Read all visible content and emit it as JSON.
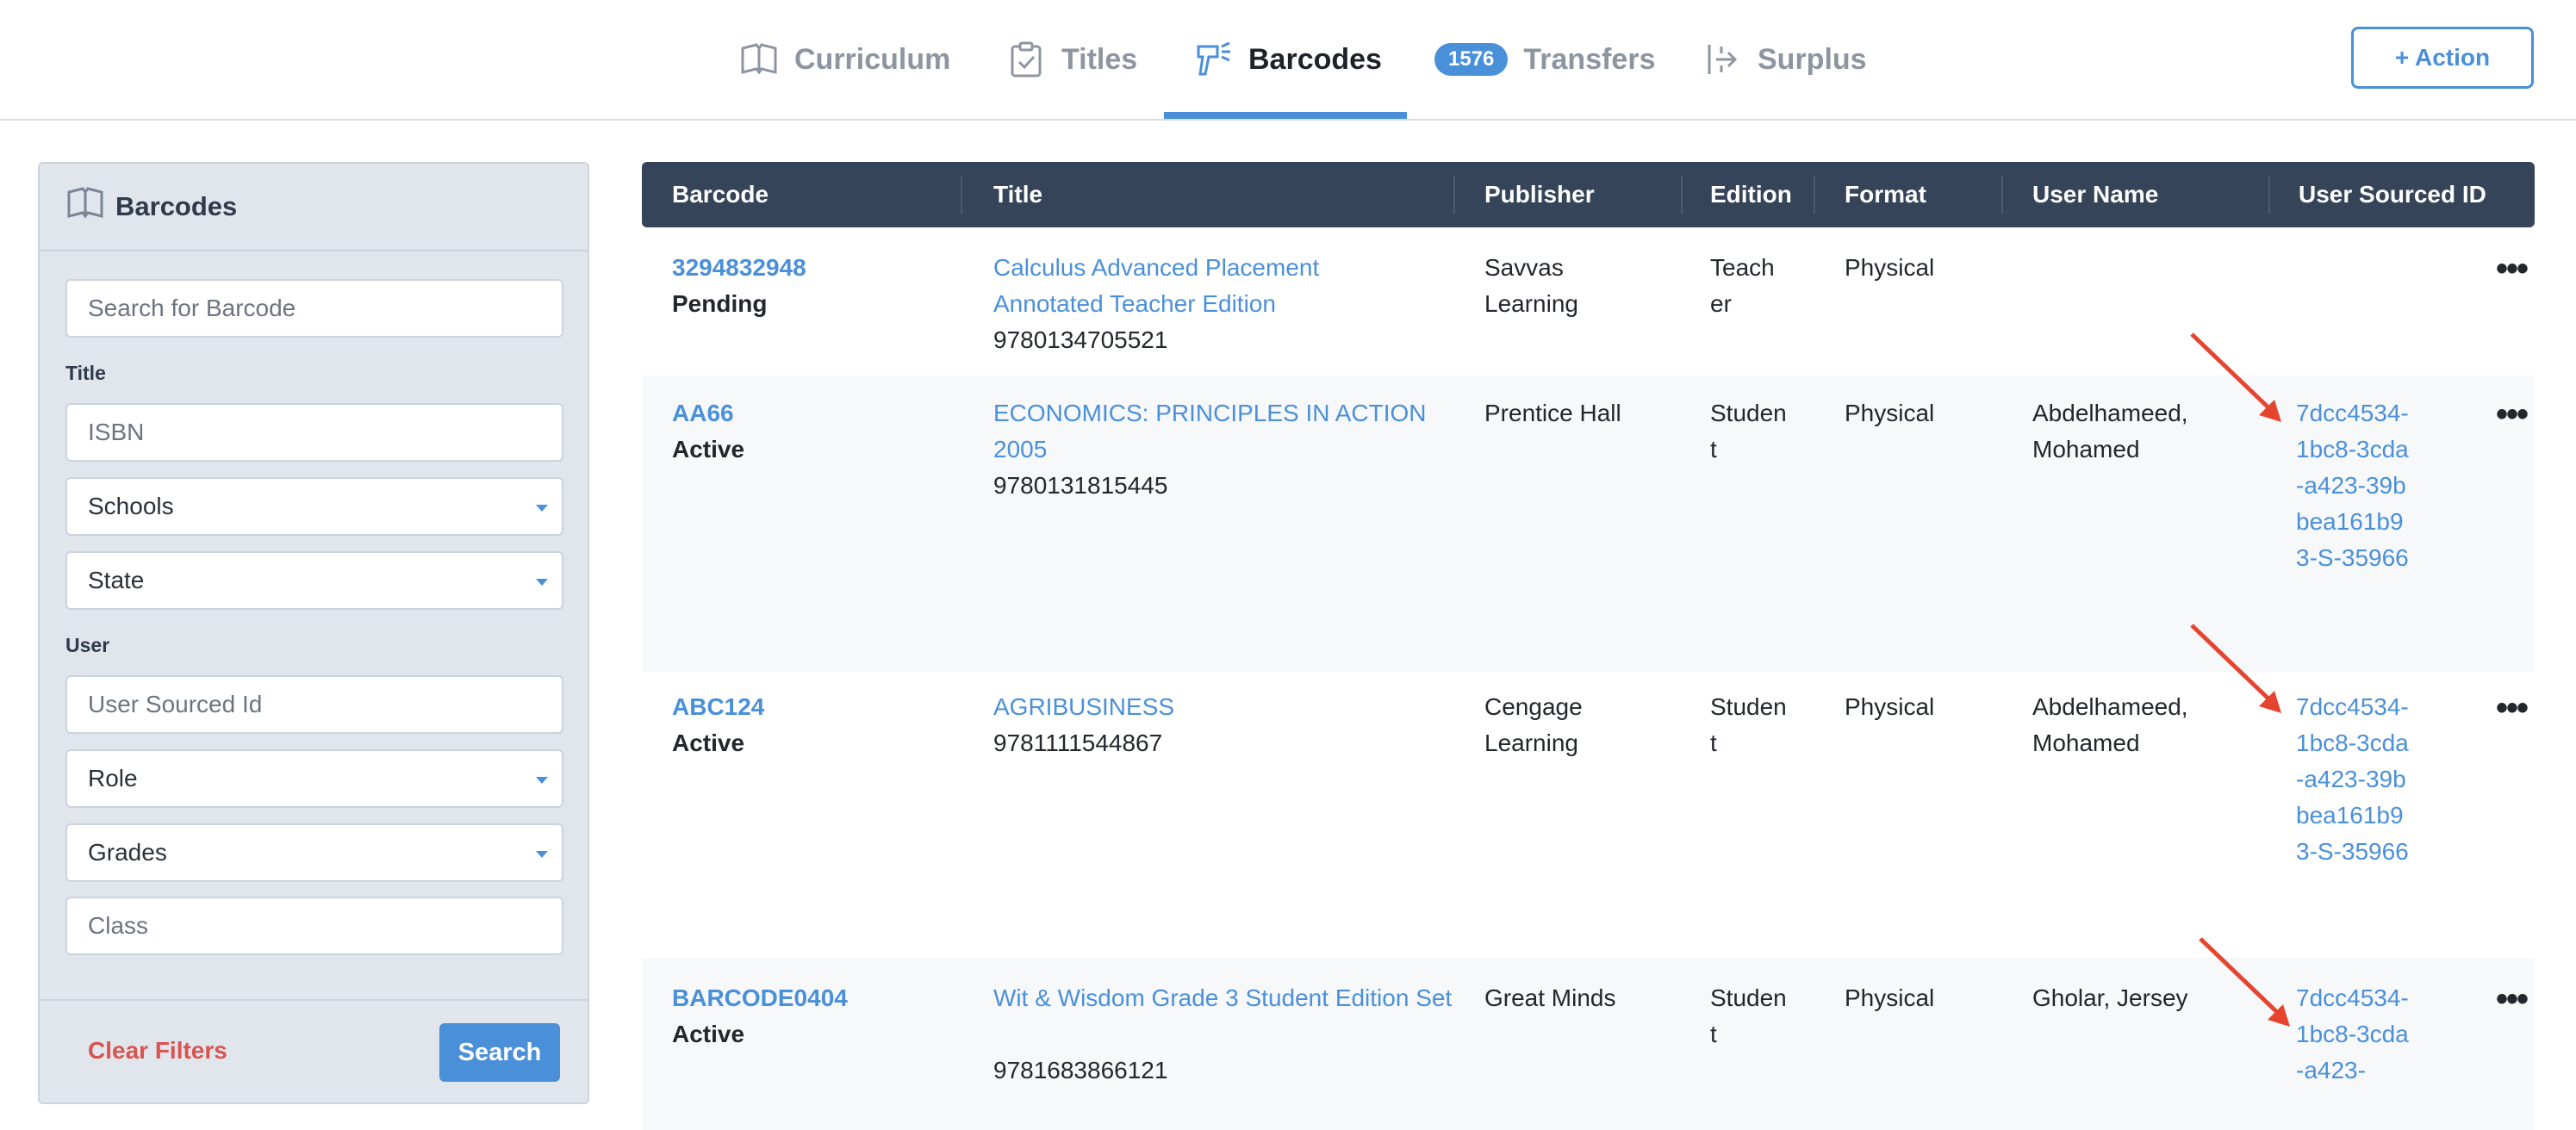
{
  "nav": {
    "tabs": [
      {
        "label": "Curriculum",
        "icon": "book-icon"
      },
      {
        "label": "Titles",
        "icon": "clipboard-check-icon"
      },
      {
        "label": "Barcodes",
        "icon": "barcode-scanner-icon",
        "active": true
      },
      {
        "label": "Transfers",
        "badge": "1576"
      },
      {
        "label": "Surplus",
        "icon": "export-icon"
      }
    ],
    "action_label": "+ Action"
  },
  "sidebar": {
    "title": "Barcodes",
    "search_placeholder": "Search for Barcode",
    "title_group": "Title",
    "isbn_placeholder": "ISBN",
    "schools": "Schools",
    "state": "State",
    "user_group": "User",
    "user_sourced_placeholder": "User Sourced Id",
    "role": "Role",
    "grades": "Grades",
    "class_placeholder": "Class",
    "clear_label": "Clear Filters",
    "search_label": "Search"
  },
  "table": {
    "headers": [
      "Barcode",
      "Title",
      "Publisher",
      "Edition",
      "Format",
      "User Name",
      "User Sourced ID"
    ],
    "rows": [
      {
        "barcode": "3294832948",
        "status": "Pending",
        "title": "Calculus Advanced Placement Annotated Teacher Edition",
        "isbn": "9780134705521",
        "publisher": "Savvas Learning",
        "edition": "Teacher",
        "format": "Physical",
        "user": "",
        "uid": ""
      },
      {
        "barcode": "AA66",
        "status": "Active",
        "title": "ECONOMICS: PRINCIPLES IN ACTION 2005",
        "isbn": "9780131815445",
        "publisher": "Prentice Hall",
        "edition": "Student",
        "format": "Physical",
        "user": "Abdelhameed, Mohamed",
        "uid": "7dcc4534-1bc8-3cda-a423-39bbea161b93-S-35966"
      },
      {
        "barcode": "ABC124",
        "status": "Active",
        "title": "AGRIBUSINESS",
        "isbn": "9781111544867",
        "publisher": "Cengage Learning",
        "edition": "Student",
        "format": "Physical",
        "user": "Abdelhameed, Mohamed",
        "uid": "7dcc4534-1bc8-3cda-a423-39bbea161b93-S-35966"
      },
      {
        "barcode": "BARCODE0404",
        "status": "Active",
        "title": "Wit & Wisdom Grade 3 Student Edition Set",
        "isbn": "9781683866121",
        "publisher": "Great Minds",
        "edition": "Student",
        "format": "Physical",
        "user": "Gholar, Jersey",
        "uid": "7dcc4534-1bc8-3cda-a423-"
      }
    ],
    "more_glyph": "•••"
  },
  "colors": {
    "accent": "#4a90d9",
    "header_bg": "#354459",
    "danger": "#d9544f",
    "annotation_arrow": "#e5452f"
  }
}
